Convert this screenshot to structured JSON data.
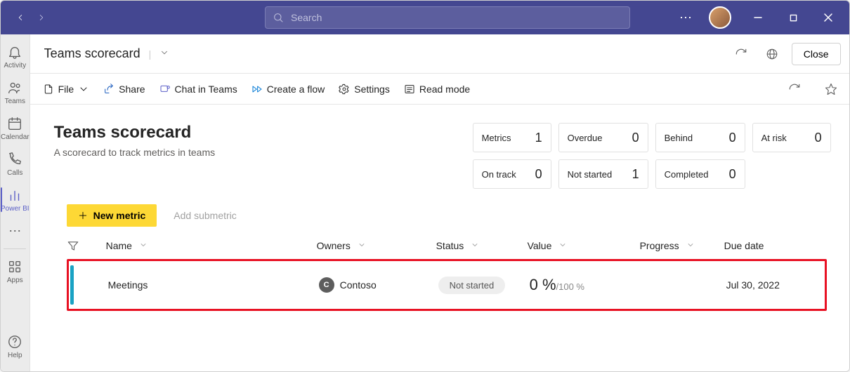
{
  "search": {
    "placeholder": "Search"
  },
  "rail": {
    "activity": "Activity",
    "teams": "Teams",
    "calendar": "Calendar",
    "calls": "Calls",
    "powerbi": "Power BI",
    "apps": "Apps",
    "help": "Help"
  },
  "header": {
    "title": "Teams scorecard",
    "close": "Close"
  },
  "toolbar": {
    "file": "File",
    "share": "Share",
    "chat": "Chat in Teams",
    "flow": "Create a flow",
    "settings": "Settings",
    "readmode": "Read mode"
  },
  "scorecard": {
    "title": "Teams scorecard",
    "subtitle": "A scorecard to track metrics in teams",
    "stats": {
      "metrics": {
        "label": "Metrics",
        "value": "1"
      },
      "overdue": {
        "label": "Overdue",
        "value": "0"
      },
      "behind": {
        "label": "Behind",
        "value": "0"
      },
      "atrisk": {
        "label": "At risk",
        "value": "0"
      },
      "ontrack": {
        "label": "On track",
        "value": "0"
      },
      "notstarted": {
        "label": "Not started",
        "value": "1"
      },
      "completed": {
        "label": "Completed",
        "value": "0"
      }
    }
  },
  "buttons": {
    "newmetric": "New metric",
    "addsub": "Add submetric"
  },
  "columns": {
    "name": "Name",
    "owners": "Owners",
    "status": "Status",
    "value": "Value",
    "progress": "Progress",
    "due": "Due date"
  },
  "row": {
    "name": "Meetings",
    "owner_initial": "C",
    "owner": "Contoso",
    "status": "Not started",
    "value_main": "0 %",
    "value_sub": "/100 %",
    "due": "Jul 30, 2022"
  }
}
